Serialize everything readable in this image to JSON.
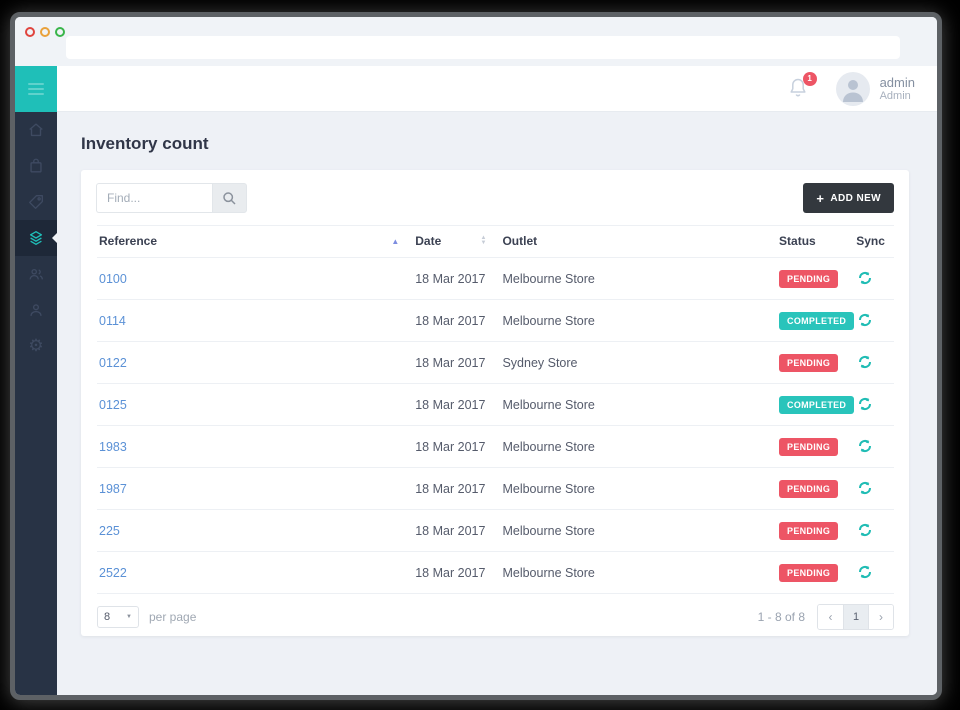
{
  "browser": {
    "traffic_lights": [
      "close",
      "minimize",
      "maximize"
    ],
    "url_value": ""
  },
  "topbar": {
    "notification_count": "1",
    "user": {
      "name": "admin",
      "role": "Admin"
    }
  },
  "sidebar": {
    "items": [
      {
        "icon": "home-icon",
        "active": false
      },
      {
        "icon": "bag-icon",
        "active": false
      },
      {
        "icon": "tag-icon",
        "active": false
      },
      {
        "icon": "layers-icon",
        "active": true
      },
      {
        "icon": "users-icon",
        "active": false
      },
      {
        "icon": "user-icon",
        "active": false
      },
      {
        "icon": "gear-icon",
        "active": false
      }
    ],
    "gear_glyph": "⚙"
  },
  "page": {
    "title": "Inventory count"
  },
  "toolbar": {
    "search_placeholder": "Find...",
    "add_new": {
      "plus_glyph": "+",
      "label": "ADD NEW"
    }
  },
  "table": {
    "columns": {
      "reference": "Reference",
      "date": "Date",
      "outlet": "Outlet",
      "status": "Status",
      "sync": "Sync"
    },
    "sort": {
      "asc_glyph": "▲",
      "desc_glyph": "▼",
      "sorted_column": "Reference",
      "direction": "asc"
    },
    "rows": [
      {
        "reference": "0100",
        "date": "18 Mar 2017",
        "outlet": "Melbourne Store",
        "status": "PENDING",
        "status_type": "pending"
      },
      {
        "reference": "0114",
        "date": "18 Mar 2017",
        "outlet": "Melbourne Store",
        "status": "COMPLETED",
        "status_type": "completed"
      },
      {
        "reference": "0122",
        "date": "18 Mar 2017",
        "outlet": "Sydney Store",
        "status": "PENDING",
        "status_type": "pending"
      },
      {
        "reference": "0125",
        "date": "18 Mar 2017",
        "outlet": "Melbourne Store",
        "status": "COMPLETED",
        "status_type": "completed"
      },
      {
        "reference": "1983",
        "date": "18 Mar 2017",
        "outlet": "Melbourne Store",
        "status": "PENDING",
        "status_type": "pending"
      },
      {
        "reference": "1987",
        "date": "18 Mar 2017",
        "outlet": "Melbourne Store",
        "status": "PENDING",
        "status_type": "pending"
      },
      {
        "reference": "225",
        "date": "18 Mar 2017",
        "outlet": "Melbourne Store",
        "status": "PENDING",
        "status_type": "pending"
      },
      {
        "reference": "2522",
        "date": "18 Mar 2017",
        "outlet": "Melbourne Store",
        "status": "PENDING",
        "status_type": "pending"
      }
    ]
  },
  "footer": {
    "per_page_value": "8",
    "per_page_caret": "▼",
    "per_page_label": "per page",
    "range_text": "1 - 8 of 8",
    "pagination": {
      "prev_glyph": "‹",
      "current_page": "1",
      "next_glyph": "›"
    }
  },
  "colors": {
    "accent_teal": "#1fbfb8",
    "sidebar_navy": "#283345",
    "status_pending": "#ed5565",
    "status_completed": "#29c4bb",
    "link_blue": "#5b91d6",
    "add_button_dark": "#33383e"
  }
}
